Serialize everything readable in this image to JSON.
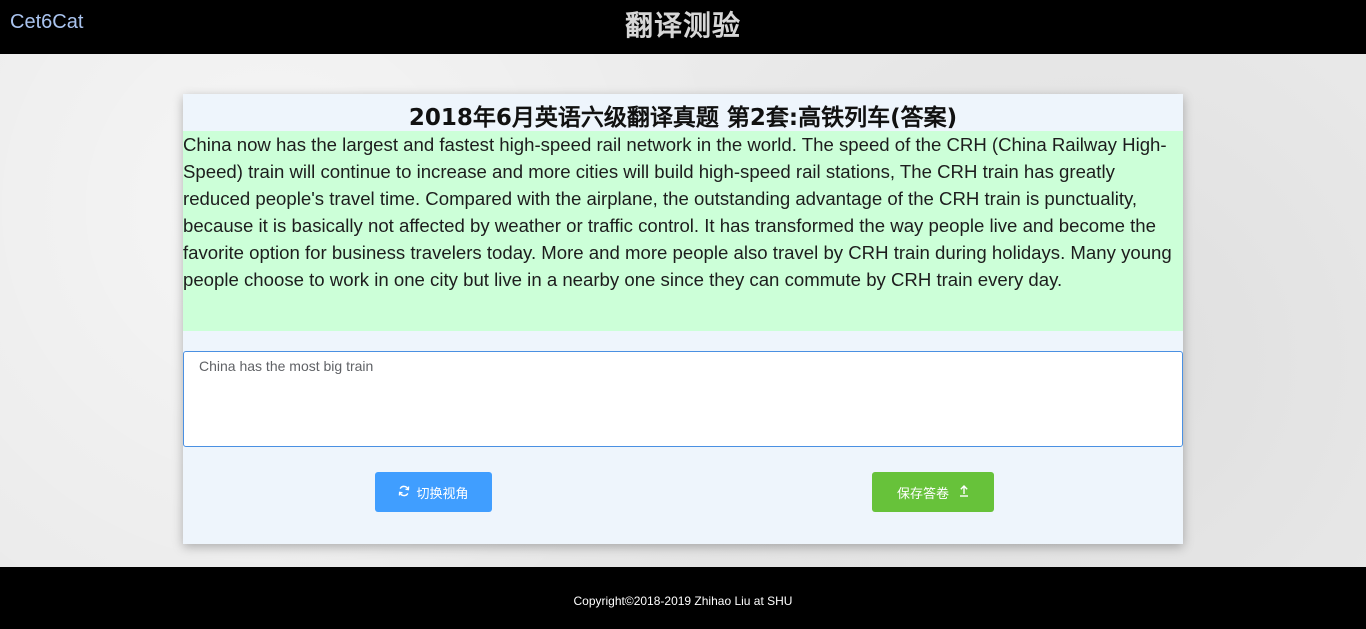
{
  "header": {
    "brand": "Cet6Cat",
    "title": "翻译测验"
  },
  "card": {
    "title": "2018年6月英语六级翻译真题 第2套:高铁列车(答案)",
    "passage": "China now has the largest and fastest high-speed rail network in the world. The speed of the CRH (China Railway High-Speed) train will continue to increase and more cities will build high-speed rail stations, The CRH train has greatly reduced people's travel time. Compared with the airplane, the outstanding advantage of the CRH train is punctuality, because it is basically not affected by weather or traffic control. It has transformed the way people live and become the favorite option for business travelers today. More and more people also travel by CRH train during holidays. Many young people choose to work in one city but live in a nearby one since they can commute by CRH train every day.",
    "answer_value": "China has the most big train"
  },
  "buttons": {
    "switch_label": "切换视角",
    "switch_icon": "refresh-icon",
    "save_label": "保存答卷",
    "save_icon": "upload-icon"
  },
  "colors": {
    "primary": "#409eff",
    "success": "#67c23a",
    "passage_bg": "#ccffd8",
    "card_bg": "#eef5fc"
  },
  "footer": {
    "copyright": "Copyright©2018-2019 Zhihao Liu at SHU"
  }
}
